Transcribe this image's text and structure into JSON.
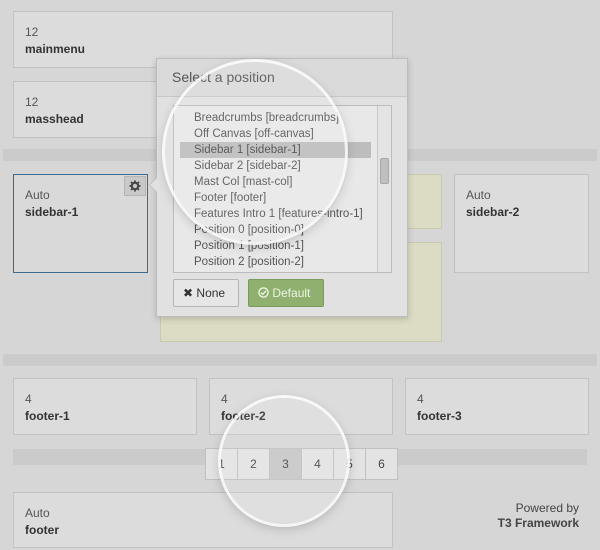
{
  "blocks": {
    "mainmenu": {
      "width": "12",
      "name": "mainmenu"
    },
    "masshead": {
      "width": "12",
      "name": "masshead"
    },
    "sidebar1": {
      "width": "Auto",
      "name": "sidebar-1"
    },
    "sidebar2": {
      "width": "Auto",
      "name": "sidebar-2"
    },
    "footer1": {
      "width": "4",
      "name": "footer-1"
    },
    "footer2": {
      "width": "4",
      "name": "footer-2"
    },
    "footer3": {
      "width": "4",
      "name": "footer-3"
    },
    "footer": {
      "width": "Auto",
      "name": "footer"
    }
  },
  "popup": {
    "title": "Select a position",
    "options": [
      "Breadcrumbs [breadcrumbs]",
      "Off Canvas [off-canvas]",
      "Sidebar 1 [sidebar-1]",
      "Sidebar 2 [sidebar-2]",
      "Mast Col [mast-col]",
      "Footer [footer]",
      "Features Intro 1 [features-intro-1]",
      "Position 0 [position-0]",
      "Position 1 [position-1]",
      "Position 2 [position-2]"
    ],
    "selected_option": "Sidebar 1 [sidebar-1]",
    "none_label": "None",
    "default_label": "Default"
  },
  "pagination": {
    "pages": [
      "1",
      "2",
      "3",
      "4",
      "5",
      "6"
    ],
    "active_page": "3"
  },
  "powered": {
    "line1": "Powered by",
    "line2": "T3 Framework"
  },
  "icons": {
    "gear": "gear-icon",
    "close": "times-icon",
    "check": "check-circle-icon"
  },
  "colors": {
    "accent_border": "#3a6b93",
    "default_button": "#8fb06e"
  }
}
